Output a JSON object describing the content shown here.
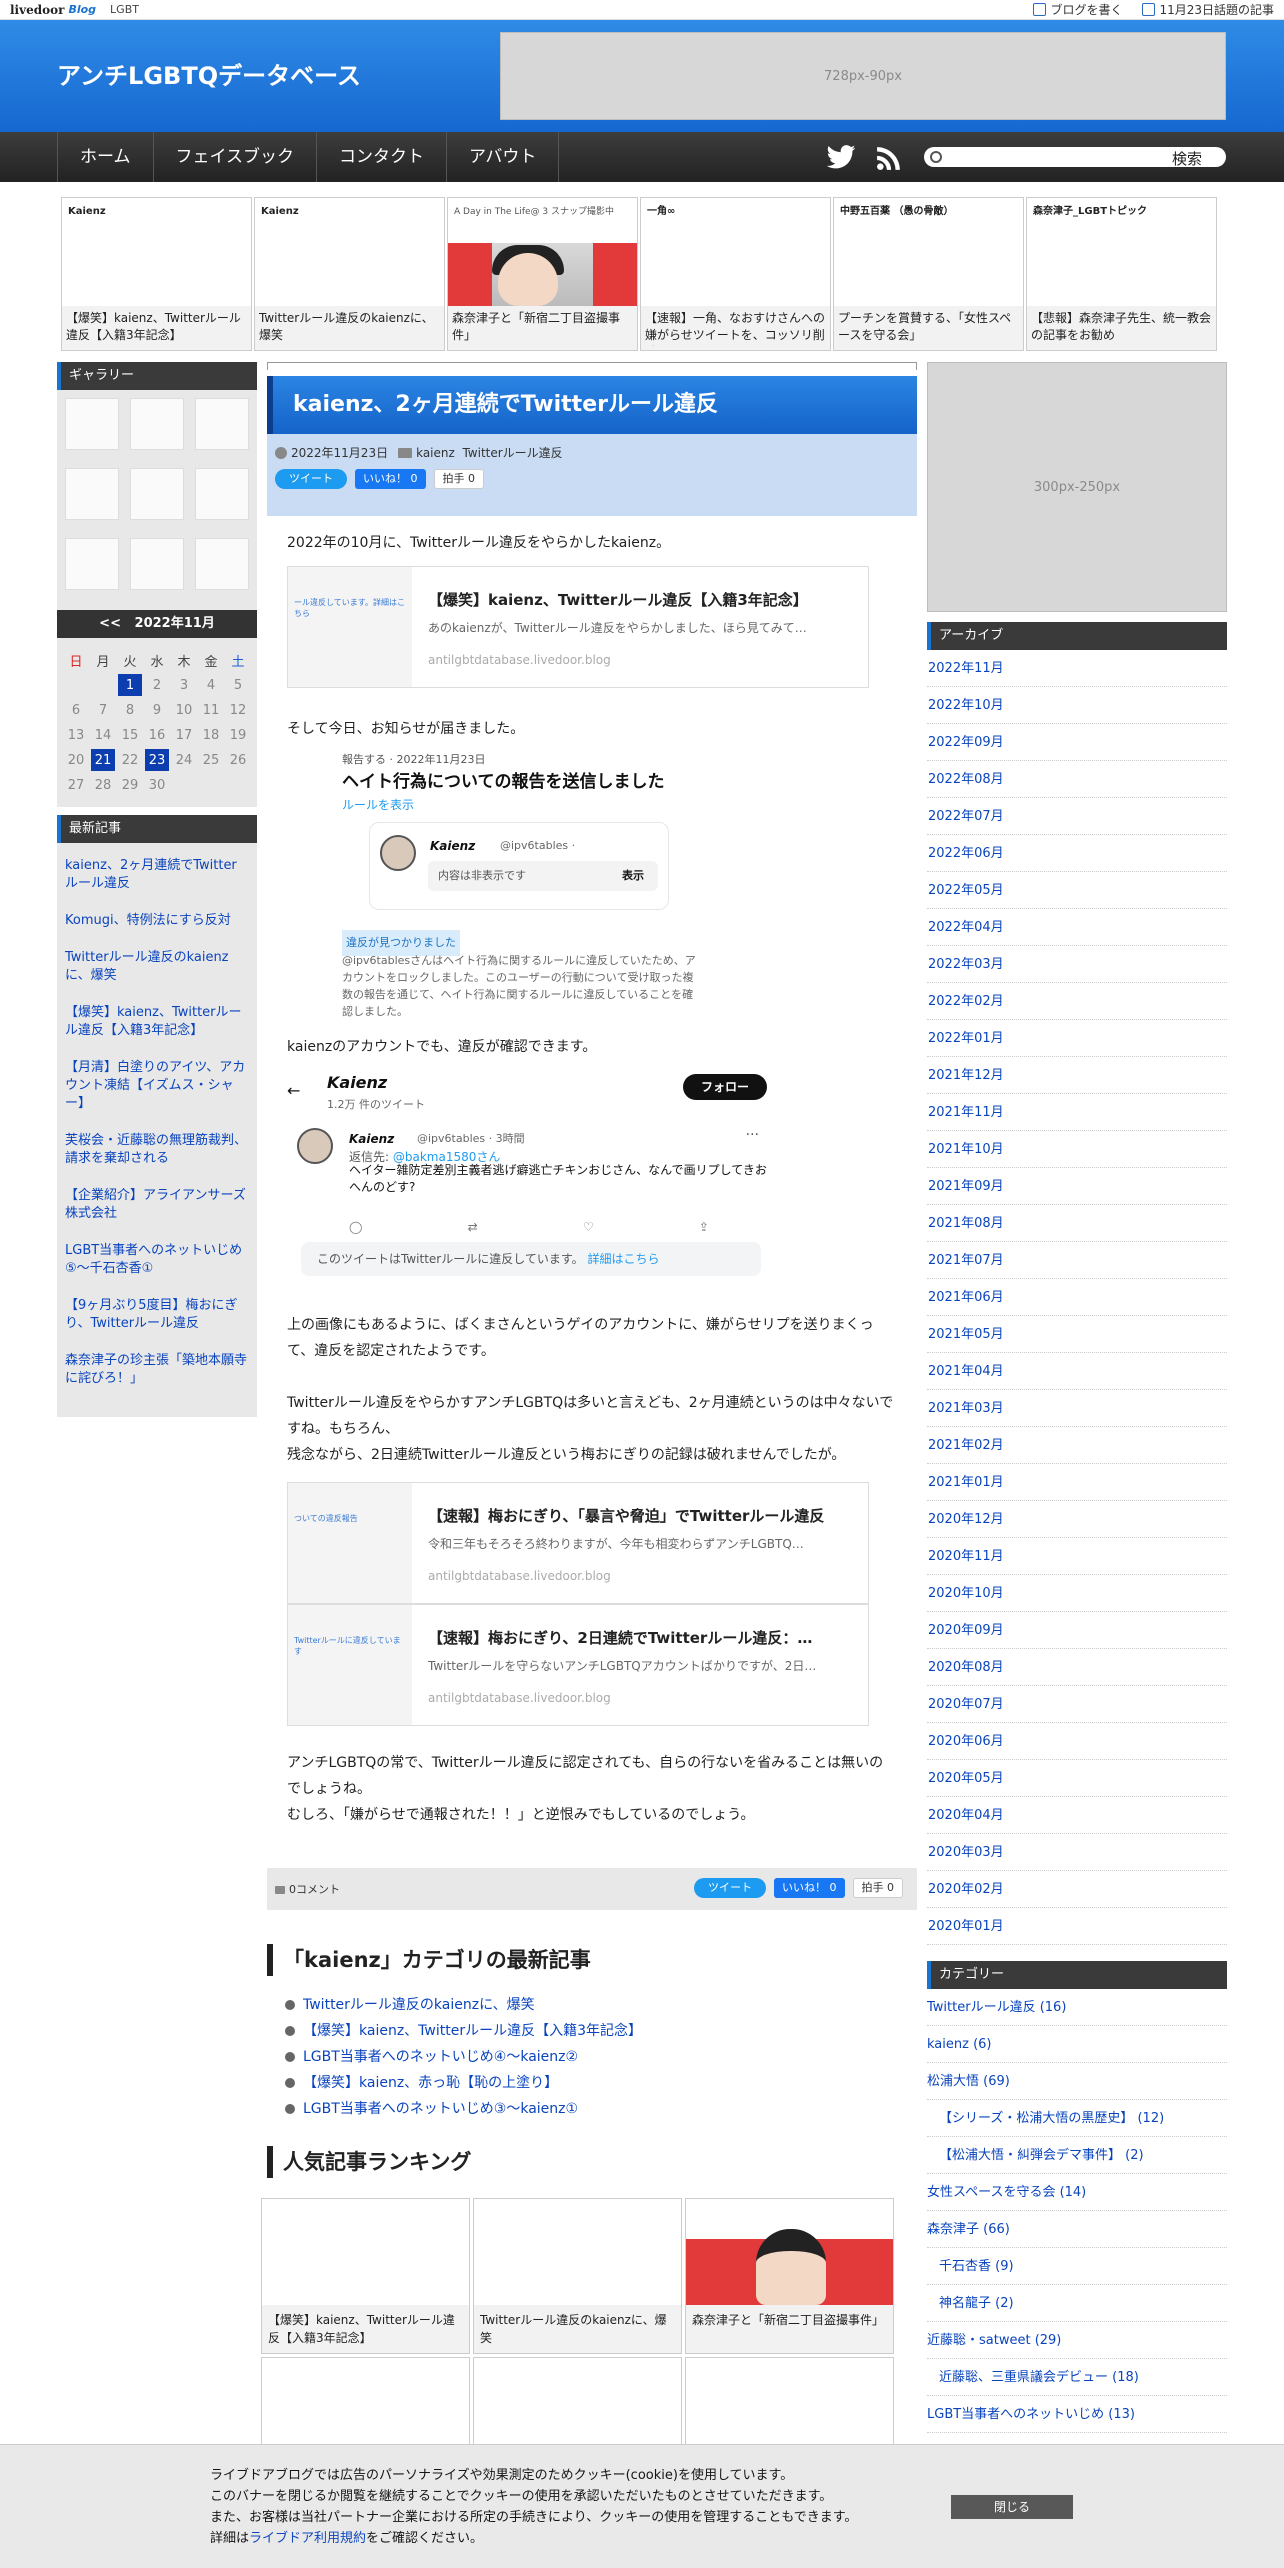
{
  "livedoor": {
    "logo": "livedoor",
    "logo_blog": "Blog",
    "category": "LGBT",
    "write": "ブログを書く",
    "today": "11月23日話題の記事"
  },
  "header": {
    "title": "アンチLGBTQデータベース",
    "ad": "728px-90px"
  },
  "nav": {
    "items": [
      "ホーム",
      "フェイスブック",
      "コンタクト",
      "アバウト"
    ],
    "search_button": "検索"
  },
  "thumbs": [
    {
      "caption": "【爆笑】kaienz、Twitterルール違反【入籍3年記念】",
      "mini": "Kaienz"
    },
    {
      "caption": "Twitterルール違反のkaienzに、爆笑",
      "mini": "Kaienz"
    },
    {
      "caption": "森奈津子と「新宿二丁目盗撮事件」",
      "mini": "A Day in The Life@ 3 スナップ撮影中"
    },
    {
      "caption": "【速報】一角、なおすけさんへの嫌がらせツイートを、コッソリ削除",
      "mini": "一角∞"
    },
    {
      "caption": "プーチンを賞賛する、「女性スペースを守る会」",
      "mini": "中野五百薬 （愚の骨敵）"
    },
    {
      "caption": "【悲報】森奈津子先生、統一教会の記事をお勧め",
      "mini": "森奈津子_LGBTトピック"
    }
  ],
  "left": {
    "gallery_title": "ギャラリー",
    "calendar": {
      "prev": "<<",
      "month": "2022年11月",
      "headers": [
        "日",
        "月",
        "火",
        "水",
        "木",
        "金",
        "土"
      ],
      "rows": [
        [
          "",
          "",
          "1",
          "2",
          "3",
          "4",
          "5"
        ],
        [
          "6",
          "7",
          "8",
          "9",
          "10",
          "11",
          "12"
        ],
        [
          "13",
          "14",
          "15",
          "16",
          "17",
          "18",
          "19"
        ],
        [
          "20",
          "21",
          "22",
          "23",
          "24",
          "25",
          "26"
        ],
        [
          "27",
          "28",
          "29",
          "30",
          "",
          "",
          ""
        ]
      ]
    },
    "recent_title": "最新記事",
    "recent": [
      "kaienz、2ヶ月連続でTwitterルール違反",
      "Komugi、特例法にすら反対",
      "Twitterルール違反のkaienzに、爆笑",
      "【爆笑】kaienz、Twitterルール違反【入籍3年記念】",
      "【月清】白塗りのアイツ、アカウント凍結【イズムス・シャー】",
      "芙桜会・近藤聡の無理筋裁判、請求を棄却される",
      "【企業紹介】アライアンサーズ株式会社",
      "LGBT当事者へのネットいじめ⑤～千石杏香①",
      "【9ヶ月ぶり5度目】梅おにぎり、Twitterルール違反",
      "森奈津子の珍主張「築地本願寺に詫びろ！」"
    ]
  },
  "article": {
    "title": "kaienz、2ヶ月連続でTwitterルール違反",
    "date": "2022年11月23日",
    "categories": [
      "kaienz",
      "Twitterルール違反"
    ],
    "tweet_btn": "ツイート",
    "like_btn": "いいね！ 0",
    "hakushu_btn": "拍手",
    "hakushu_count": "0",
    "p1": "2022年の10月に、Twitterルール違反をやらかしたkaienz。",
    "card1": {
      "title": "【爆笑】kaienz、Twitterルール違反【入籍3年記念】",
      "desc": "あのkaienzが、Twitterルール違反をやらかしました、ほら見てみて…",
      "url": "antilgbtdatabase.livedoor.blog",
      "mini": "ール違反しています。詳細はこちら"
    },
    "p2": "そして今日、お知らせが届きました。",
    "report": {
      "line1": "報告する · 2022年11月23日",
      "line2": "ヘイト行為についての報告を送信しました",
      "line3": "ルールを表示",
      "name": "Kaienz",
      "handle": "@ipv6tables ·",
      "hidden": "内容は非表示です",
      "show": "表示",
      "badge": "違反が見つかりました",
      "note": "@ipv6tablesさんはヘイト行為に関するルールに違反していたため、アカウントをロックしました。このユーザーの行動について受け取った複数の報告を通じて、ヘイト行為に関するルールに違反していることを確認しました。"
    },
    "p3": "kaienzのアカウントでも、違反が確認できます。",
    "tweet": {
      "name": "Kaienz",
      "count": "1.2万 件のツイート",
      "follow": "フォロー",
      "handle": "@ipv6tables · 3時間",
      "reply_prefix": "返信先:",
      "reply_to": "@bakma1580さん",
      "text": "ヘイター雑防定差別主義者逃げ癖逃亡チキンおじさん、なんで画リプしてきおへんのどす?",
      "notice": "このツイートはTwitterルールに違反しています。",
      "notice_link": "詳細はこちら"
    },
    "p4": "上の画像にもあるように、ばくまさんというゲイのアカウントに、嫌がらせリプを送りまくって、違反を認定されたようです。",
    "p5a": "Twitterルール違反をやらかすアンチLGBTQは多いと言えども、2ヶ月連続というのは中々ないですね。もちろん、",
    "p5b": "残念ながら、2日連続Twitterルール違反という梅おにぎりの記録は破れませんでしたが。",
    "card2": {
      "title": "【速報】梅おにぎり、「暴言や脅迫」でTwitterルール違反",
      "desc": "令和三年もそろそろ終わりますが、今年も相変わらずアンチLGBTQ…",
      "url": "antilgbtdatabase.livedoor.blog",
      "mini": "ついての違反報告"
    },
    "card3": {
      "title": "【速報】梅おにぎり、2日連続でTwitterルール違反：…",
      "desc": "Twitterルールを守らないアンチLGBTQアカウントばかりですが、2日…",
      "url": "antilgbtdatabase.livedoor.blog",
      "mini": "Twitterルールに違反しています"
    },
    "p6a": "アンチLGBTQの常で、Twitterルール違反に認定されても、自らの行ないを省みることは無いのでしょうね。",
    "p6b": "むしろ、「嫌がらせで通報された！！」と逆恨みでもしているのでしょう。",
    "comments": "0コメント"
  },
  "category_section": {
    "title": "「kaienz」カテゴリの最新記事",
    "items": [
      "Twitterルール違反のkaienzに、爆笑",
      "【爆笑】kaienz、Twitterルール違反【入籍3年記念】",
      "LGBT当事者へのネットいじめ④～kaienz②",
      "【爆笑】kaienz、赤っ恥【恥の上塗り】",
      "LGBT当事者へのネットいじめ③～kaienz①"
    ]
  },
  "ranking": {
    "title": "人気記事ランキング",
    "items": [
      {
        "caption": "【爆笑】kaienz、Twitterルール違反【入籍3年記念】"
      },
      {
        "caption": "Twitterルール違反のkaienzに、爆笑"
      },
      {
        "caption": "森奈津子と「新宿二丁目盗撮事件」"
      },
      {
        "caption": ""
      },
      {
        "caption": ""
      },
      {
        "caption": ""
      }
    ]
  },
  "right": {
    "ad": "300px-250px",
    "archive_title": "アーカイブ",
    "archive": [
      "2022年11月",
      "2022年10月",
      "2022年09月",
      "2022年08月",
      "2022年07月",
      "2022年06月",
      "2022年05月",
      "2022年04月",
      "2022年03月",
      "2022年02月",
      "2022年01月",
      "2021年12月",
      "2021年11月",
      "2021年10月",
      "2021年09月",
      "2021年08月",
      "2021年07月",
      "2021年06月",
      "2021年05月",
      "2021年04月",
      "2021年03月",
      "2021年02月",
      "2021年01月",
      "2020年12月",
      "2020年11月",
      "2020年10月",
      "2020年09月",
      "2020年08月",
      "2020年07月",
      "2020年06月",
      "2020年05月",
      "2020年04月",
      "2020年03月",
      "2020年02月",
      "2020年01月"
    ],
    "category_title": "カテゴリー",
    "categories": [
      {
        "label": "Twitterルール違反 (16)",
        "sub": false
      },
      {
        "label": "kaienz (6)",
        "sub": false
      },
      {
        "label": "松浦大悟 (69)",
        "sub": false
      },
      {
        "label": "【シリーズ・松浦大悟の黒歴史】 (12)",
        "sub": true
      },
      {
        "label": "【松浦大悟・糾弾会デマ事件】 (2)",
        "sub": true
      },
      {
        "label": "女性スペースを守る会 (14)",
        "sub": false
      },
      {
        "label": "森奈津子 (66)",
        "sub": false
      },
      {
        "label": "千石杏香 (9)",
        "sub": true
      },
      {
        "label": "神名龍子 (2)",
        "sub": true
      },
      {
        "label": "近藤聡・satweet (29)",
        "sub": false
      },
      {
        "label": "近藤聡、三重県議会デビュー (18)",
        "sub": true
      },
      {
        "label": "LGBT当事者へのネットいじめ (13)",
        "sub": false
      }
    ]
  },
  "cookie": {
    "line1": "ライブドアブログでは広告のパーソナライズや効果測定のためクッキー(cookie)を使用しています。",
    "line2": "このバナーを閉じるか閲覧を継続することでクッキーの使用を承認いただいたものとさせていただきます。",
    "line3": "また、お客様は当社パートナー企業における所定の手続きにより、クッキーの使用を管理することもできます。",
    "line4_pre": "詳細は",
    "line4_link": "ライブドア利用規約",
    "line4_post": "をご確認ください。",
    "close": "閉じる"
  }
}
